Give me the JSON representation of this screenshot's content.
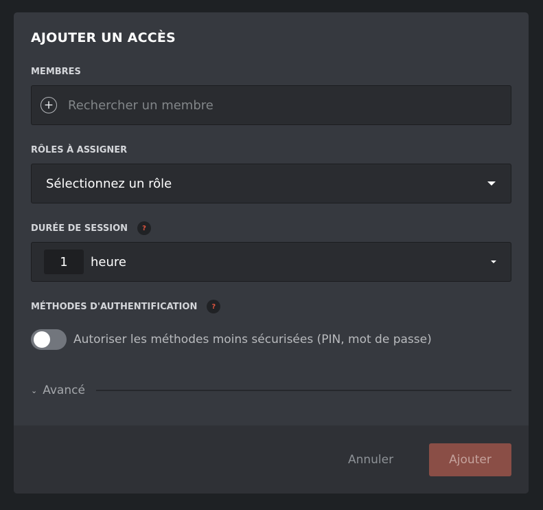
{
  "dialog": {
    "title": "AJOUTER UN ACCÈS"
  },
  "members": {
    "label": "MEMBRES",
    "placeholder": "Rechercher un membre",
    "icon": "plus-circle-icon"
  },
  "roles": {
    "label": "RÔLES À ASSIGNER",
    "selected": "Sélectionnez un rôle"
  },
  "session": {
    "label": "DURÉE DE SESSION",
    "help": "?",
    "value": "1",
    "unit": "heure"
  },
  "auth": {
    "label": "MÉTHODES D'AUTHENTIFICATION",
    "help": "?",
    "toggle_label": "Autoriser les méthodes moins sécurisées (PIN, mot de passe)",
    "toggle_on": false
  },
  "advanced": {
    "label": "Avancé"
  },
  "footer": {
    "cancel_label": "Annuler",
    "submit_label": "Ajouter"
  },
  "colors": {
    "accent": "#8a4e46",
    "help_mark": "#e0553f",
    "background": "#36393f"
  }
}
